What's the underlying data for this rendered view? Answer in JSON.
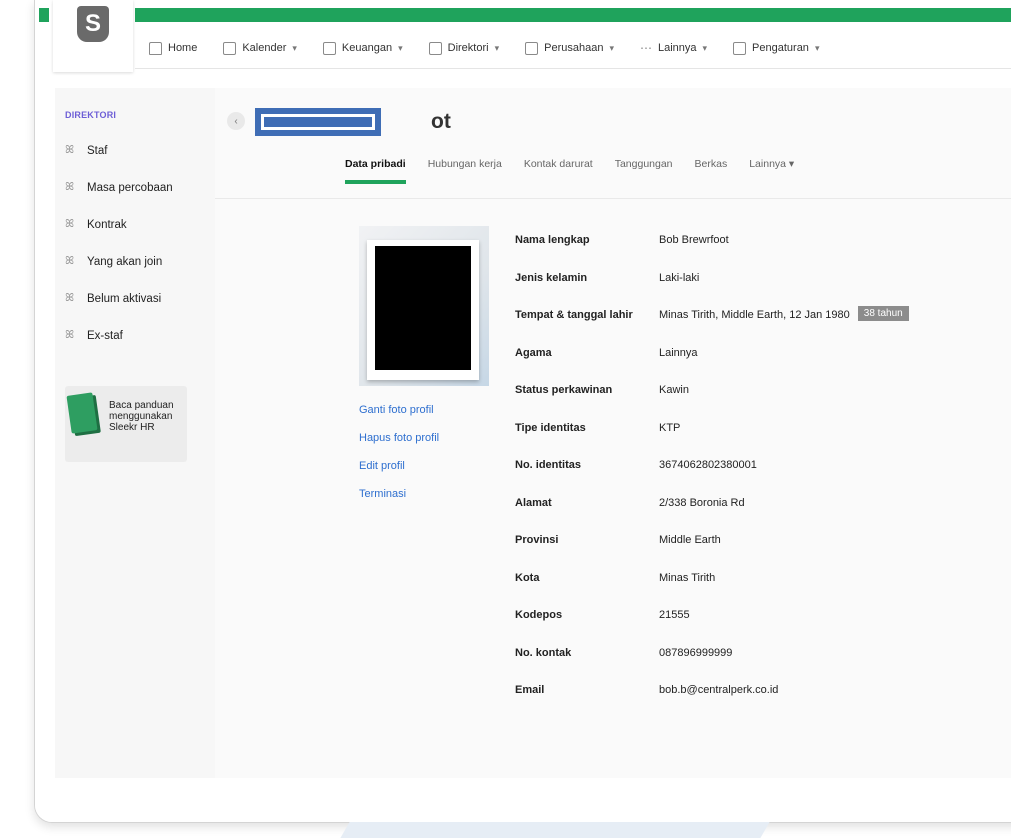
{
  "nav": {
    "items": [
      {
        "label": "Home",
        "icon": "home-icon"
      },
      {
        "label": "Kalender",
        "icon": "calendar-icon",
        "dropdown": true
      },
      {
        "label": "Keuangan",
        "icon": "finance-icon",
        "dropdown": true
      },
      {
        "label": "Direktori",
        "icon": "directory-icon",
        "dropdown": true
      },
      {
        "label": "Perusahaan",
        "icon": "company-icon",
        "dropdown": true
      },
      {
        "label": "Lainnya",
        "icon": "more-icon",
        "dropdown": true
      },
      {
        "label": "Pengaturan",
        "icon": "settings-icon",
        "dropdown": true
      }
    ],
    "caret": "▾"
  },
  "logo": {
    "letter": "S"
  },
  "sidebar": {
    "heading": "DIREKTORI",
    "items": [
      {
        "label": "Staf"
      },
      {
        "label": "Masa percobaan"
      },
      {
        "label": "Kontrak"
      },
      {
        "label": "Yang akan join"
      },
      {
        "label": "Belum aktivasi"
      },
      {
        "label": "Ex-staf"
      }
    ],
    "guide": {
      "line1": "Baca panduan",
      "line2": "menggunakan",
      "line3": "Sleekr HR"
    }
  },
  "page": {
    "title_visible": "ot",
    "back_icon": "‹",
    "tabs": [
      {
        "label": "Data pribadi",
        "active": true
      },
      {
        "label": "Hubungan kerja"
      },
      {
        "label": "Kontak darurat"
      },
      {
        "label": "Tanggungan"
      },
      {
        "label": "Berkas"
      },
      {
        "label": "Lainnya ▾"
      }
    ]
  },
  "profile_links": {
    "change_photo": "Ganti foto profil",
    "delete_photo": "Hapus foto profil",
    "edit": "Edit profil",
    "terminate": "Terminasi"
  },
  "details": [
    {
      "label": "Nama lengkap",
      "value": "Bob Brewrfoot"
    },
    {
      "label": "Jenis kelamin",
      "value": "Laki-laki"
    },
    {
      "label": "Tempat & tanggal lahir",
      "value": "Minas Tirith, Middle Earth, 12 Jan 1980",
      "badge": "38 tahun"
    },
    {
      "label": "Agama",
      "value": "Lainnya"
    },
    {
      "label": "Status perkawinan",
      "value": "Kawin"
    },
    {
      "label": "Tipe identitas",
      "value": "KTP"
    },
    {
      "label": "No. identitas",
      "value": "3674062802380001"
    },
    {
      "label": "Alamat",
      "value": "2/338 Boronia Rd"
    },
    {
      "label": "Provinsi",
      "value": "Middle Earth"
    },
    {
      "label": "Kota",
      "value": "Minas Tirith"
    },
    {
      "label": "Kodepos",
      "value": "21555"
    },
    {
      "label": "No. kontak",
      "value": "087896999999"
    },
    {
      "label": "Email",
      "value": "bob.b@centralperk.co.id"
    }
  ],
  "colors": {
    "brand_green": "#1fa35c",
    "link_blue": "#2e6fcf",
    "redaction_blue": "#3f6db5"
  }
}
